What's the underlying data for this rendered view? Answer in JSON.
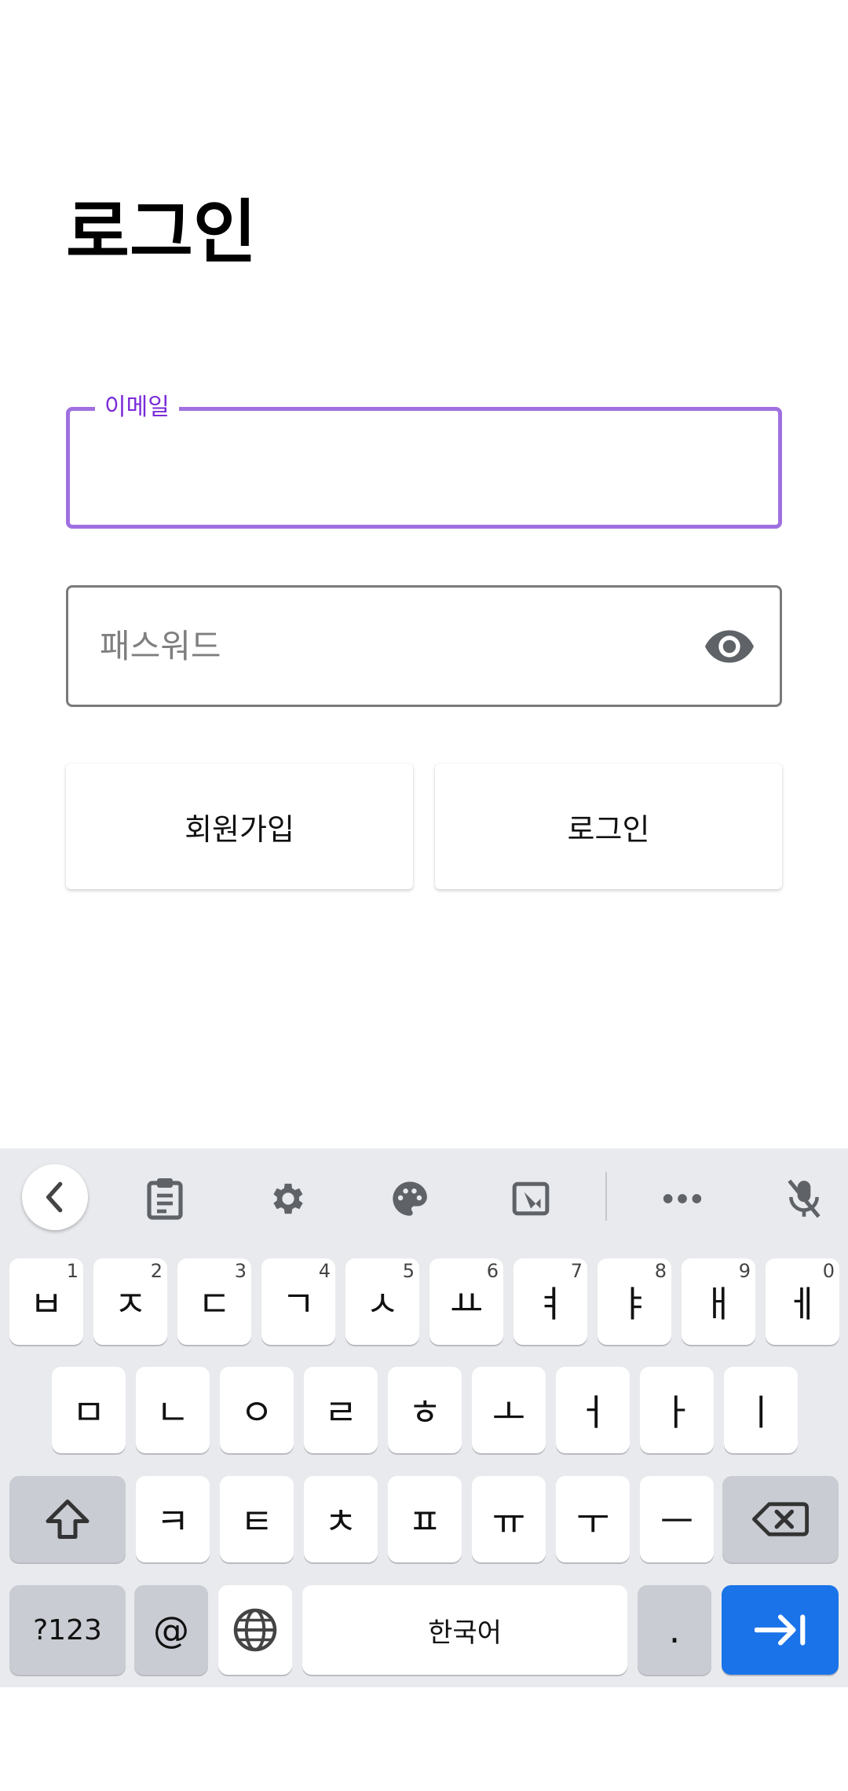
{
  "page": {
    "title": "로그인",
    "email": {
      "label": "이메일",
      "value": ""
    },
    "password": {
      "placeholder": "패스워드",
      "value": ""
    },
    "buttons": {
      "signup": "회원가입",
      "login": "로그인"
    }
  },
  "keyboard": {
    "toolbar": {
      "icons": [
        "back-chevron-icon",
        "clipboard-icon",
        "settings-gear-icon",
        "theme-palette-icon",
        "floating-keyboard-icon",
        "more-dots-icon",
        "mic-off-icon"
      ]
    },
    "row1": [
      {
        "label": "ㅂ",
        "hint": "1"
      },
      {
        "label": "ㅈ",
        "hint": "2"
      },
      {
        "label": "ㄷ",
        "hint": "3"
      },
      {
        "label": "ㄱ",
        "hint": "4"
      },
      {
        "label": "ㅅ",
        "hint": "5"
      },
      {
        "label": "ㅛ",
        "hint": "6"
      },
      {
        "label": "ㅕ",
        "hint": "7"
      },
      {
        "label": "ㅑ",
        "hint": "8"
      },
      {
        "label": "ㅐ",
        "hint": "9"
      },
      {
        "label": "ㅔ",
        "hint": "0"
      }
    ],
    "row2": [
      "ㅁ",
      "ㄴ",
      "ㅇ",
      "ㄹ",
      "ㅎ",
      "ㅗ",
      "ㅓ",
      "ㅏ",
      "ㅣ"
    ],
    "row3": [
      "ㅋ",
      "ㅌ",
      "ㅊ",
      "ㅍ",
      "ㅠ",
      "ㅜ",
      "ㅡ"
    ],
    "row4": {
      "symbols": "?123",
      "at": "@",
      "space": "한국어",
      "period": "."
    },
    "colors": {
      "background": "#e8eaed",
      "action": "#1a73e8",
      "focus": "#a070e0"
    }
  }
}
